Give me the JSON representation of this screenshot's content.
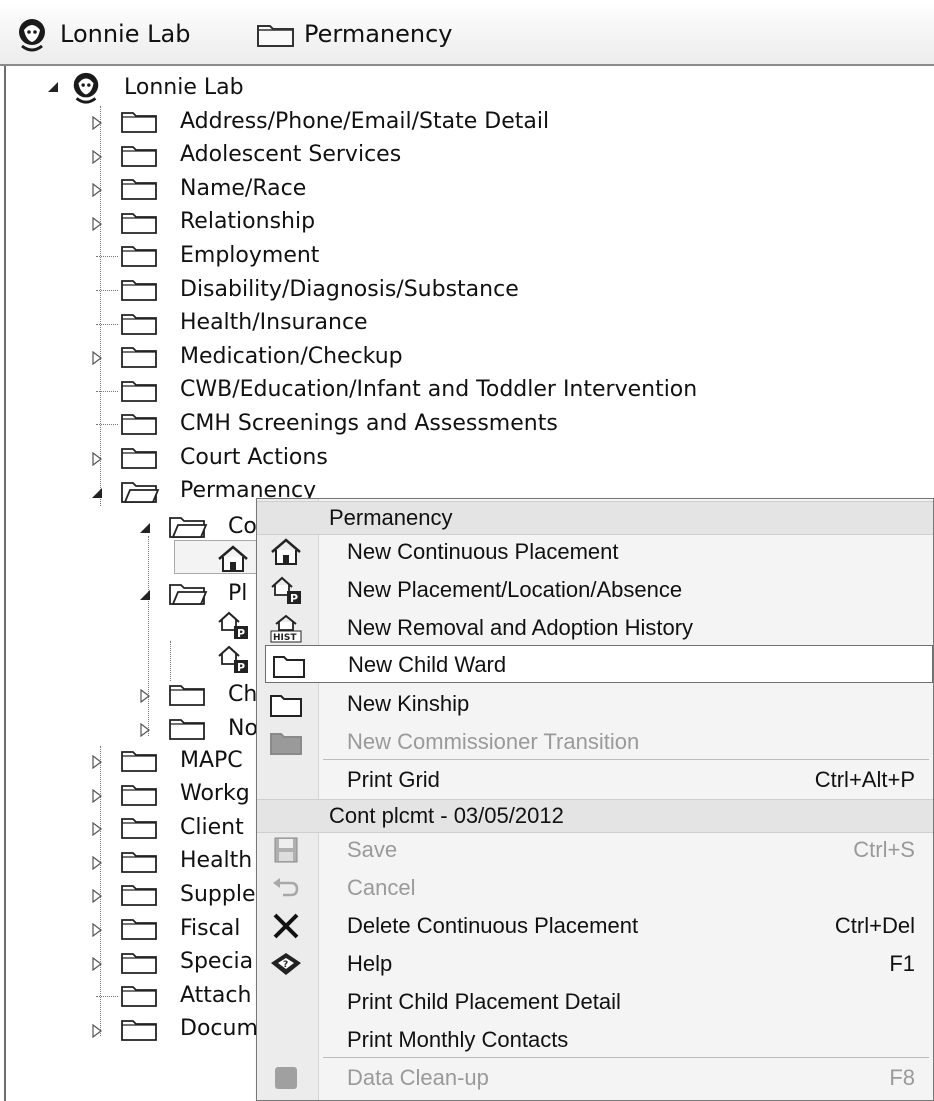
{
  "titlebar": {
    "person_name": "Lonnie Lab",
    "section_name": "Permanency",
    "person_icon": "person-head-icon",
    "section_icon": "folder-icon"
  },
  "tree": {
    "root": {
      "label": "Lonnie Lab",
      "icon": "person-head-icon"
    },
    "items": [
      {
        "label": "Address/Phone/Email/State Detail",
        "expandable": true
      },
      {
        "label": "Adolescent Services",
        "expandable": true
      },
      {
        "label": "Name/Race",
        "expandable": true
      },
      {
        "label": "Relationship",
        "expandable": true
      },
      {
        "label": "Employment",
        "expandable": false
      },
      {
        "label": "Disability/Diagnosis/Substance",
        "expandable": false
      },
      {
        "label": "Health/Insurance",
        "expandable": false
      },
      {
        "label": "Medication/Checkup",
        "expandable": true
      },
      {
        "label": "CWB/Education/Infant and Toddler Intervention",
        "expandable": false
      },
      {
        "label": "CMH Screenings and Assessments",
        "expandable": false
      },
      {
        "label": "Court Actions",
        "expandable": true
      },
      {
        "label": "Permanency",
        "expandable": true,
        "expanded": true,
        "selected": true
      }
    ],
    "permanency_children": [
      {
        "label": "Co",
        "expanded": true
      },
      {
        "label": "Pl",
        "expanded": true
      },
      {
        "label": "Ch",
        "expanded": false
      },
      {
        "label": "No",
        "expanded": false
      }
    ],
    "items_after": [
      {
        "label": "MAPC",
        "expandable": true
      },
      {
        "label": "Workg",
        "expandable": true
      },
      {
        "label": "Client",
        "expandable": true
      },
      {
        "label": "Health",
        "expandable": true
      },
      {
        "label": "Supple",
        "expandable": true
      },
      {
        "label": "Fiscal",
        "expandable": true
      },
      {
        "label": "Specia",
        "expandable": true
      },
      {
        "label": "Attach",
        "expandable": false
      },
      {
        "label": "Docum",
        "expandable": true
      }
    ]
  },
  "context_menu": {
    "section1_header": "Permanency",
    "new_continuous_placement": "New Continuous Placement",
    "new_placement_location_absence": "New Placement/Location/Absence",
    "new_removal_adoption_history": "New Removal and Adoption History",
    "new_child_ward": "New Child Ward",
    "new_kinship": "New Kinship",
    "new_commissioner_transition": "New Commissioner Transition",
    "print_grid": "Print Grid",
    "print_grid_shortcut": "Ctrl+Alt+P",
    "section2_header": "Cont plcmt - 03/05/2012",
    "save": "Save",
    "save_shortcut": "Ctrl+S",
    "cancel": "Cancel",
    "delete_continuous_placement": "Delete Continuous Placement",
    "delete_shortcut": "Ctrl+Del",
    "help": "Help",
    "help_shortcut": "F1",
    "print_child_placement_detail": "Print Child Placement Detail",
    "print_monthly_contacts": "Print Monthly Contacts",
    "data_clean_up": "Data Clean-up",
    "data_clean_up_shortcut": "F8"
  },
  "colors": {
    "disabled_text": "#9a9a9a",
    "menu_bg": "#f4f4f4",
    "highlight_border": "#6f6f6f"
  }
}
